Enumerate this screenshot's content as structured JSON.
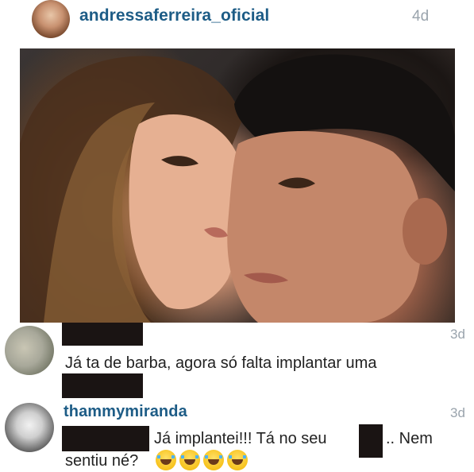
{
  "post": {
    "username": "andressaferreira_oficial",
    "age": "4d"
  },
  "comments": [
    {
      "age": "3d",
      "text": "Já ta de barba, agora só falta implantar uma"
    },
    {
      "username": "thammymiranda",
      "age": "3d",
      "text_part1": "Já implantei!!! Tá no seu",
      "text_part2": ".. Nem",
      "text_part3": "sentiu né?",
      "emoji_icon": "face-with-tears-of-joy-icon",
      "emoji_count": 4
    }
  ],
  "colors": {
    "username": "#1d5c86",
    "timestamp": "#9aa4ad",
    "redaction": "#1a1413"
  }
}
